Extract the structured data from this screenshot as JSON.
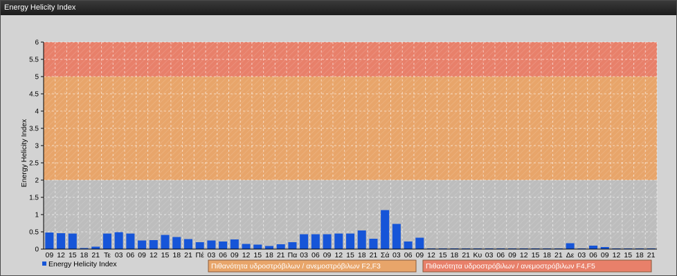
{
  "window": {
    "title": "Energy Helicity Index"
  },
  "legend": {
    "series_label": "Energy Helicity Index",
    "series_color": "#1655d8"
  },
  "bands": [
    {
      "from": 2,
      "to": 5,
      "color": "#e8a56a",
      "label": "Πιθανότητα υδροστρόβιλων / ανεμοστρόβιλων F2,F3"
    },
    {
      "from": 5,
      "to": 6,
      "color": "#e8806a",
      "label": "Πιθανότητα υδροστρόβιλων / ανεμοστρόβιλων F4,F5"
    }
  ],
  "chart_data": {
    "type": "bar",
    "title": "",
    "ylabel": "Energy Helicity Index",
    "xlabel": "",
    "ylim": [
      0,
      6
    ],
    "yticks": [
      "0",
      "0.5",
      "1",
      "1.5",
      "2",
      "2.5",
      "3",
      "3.5",
      "4",
      "4.5",
      "5",
      "5.5",
      "6"
    ],
    "grid": true,
    "legend_position": "bottom-left",
    "categories": [
      "09",
      "12",
      "15",
      "18",
      "21",
      "Τε",
      "03",
      "06",
      "09",
      "12",
      "15",
      "18",
      "21",
      "Πέ",
      "03",
      "06",
      "09",
      "12",
      "15",
      "18",
      "21",
      "Πα",
      "03",
      "06",
      "09",
      "12",
      "15",
      "18",
      "21",
      "Σά",
      "03",
      "06",
      "09",
      "12",
      "15",
      "18",
      "21",
      "Κυ",
      "03",
      "06",
      "09",
      "12",
      "15",
      "18",
      "21",
      "Δε",
      "03",
      "06",
      "09",
      "12",
      "15",
      "18",
      "21"
    ],
    "series": [
      {
        "name": "Energy Helicity Index",
        "values": [
          0.48,
          0.46,
          0.45,
          0.03,
          0.07,
          0.45,
          0.49,
          0.45,
          0.25,
          0.26,
          0.41,
          0.35,
          0.29,
          0.2,
          0.25,
          0.22,
          0.28,
          0.15,
          0.13,
          0.09,
          0.14,
          0.2,
          0.43,
          0.43,
          0.43,
          0.45,
          0.45,
          0.54,
          0.3,
          1.13,
          0.73,
          0.22,
          0.33,
          0.02,
          0.02,
          0.02,
          0.02,
          0.02,
          0.02,
          0.02,
          0.02,
          0.02,
          0.02,
          0.02,
          0.02,
          0.17,
          0.02,
          0.1,
          0.06,
          0.02,
          0.02,
          0.02,
          0.02
        ]
      }
    ]
  }
}
